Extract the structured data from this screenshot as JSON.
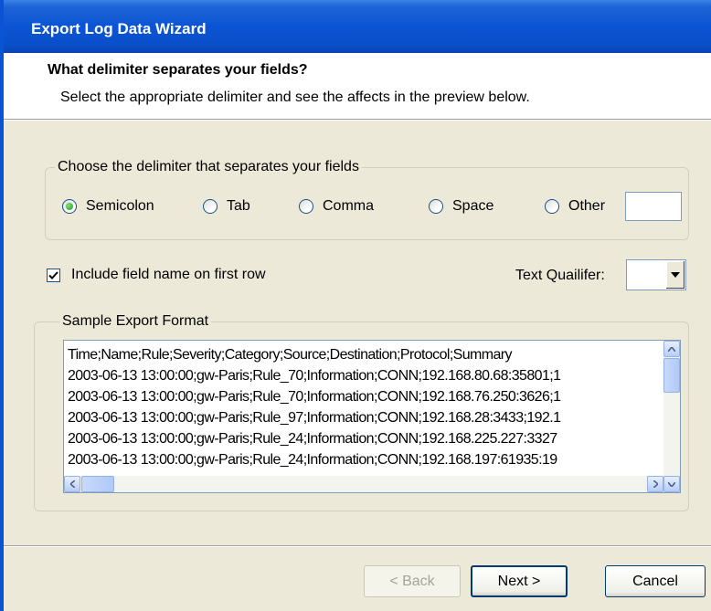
{
  "window": {
    "title": "Export Log Data Wizard"
  },
  "header": {
    "title": "What delimiter separates your fields?",
    "subtitle": "Select the appropriate delimiter and see the affects in the preview below."
  },
  "delimiter_group": {
    "legend": "Choose the delimiter that separates your fields",
    "options": [
      "Semicolon",
      "Tab",
      "Comma",
      "Space",
      "Other"
    ],
    "selected": "Semicolon",
    "other_value": ""
  },
  "include_field_names": {
    "label": "Include field name on first row",
    "checked": true
  },
  "text_qualifier": {
    "label": "Text Quailifer:",
    "value": ""
  },
  "sample_group": {
    "legend": "Sample Export Format",
    "lines": [
      "Time;Name;Rule;Severity;Category;Source;Destination;Protocol;Summary",
      "2003-06-13 13:00:00;gw-Paris;Rule_70;Information;CONN;192.168.80.68:35801;1",
      "2003-06-13 13:00:00;gw-Paris;Rule_70;Information;CONN;192.168.76.250:3626;1",
      "2003-06-13 13:00:00;gw-Paris;Rule_97;Information;CONN;192.168.28:3433;192.1",
      "2003-06-13 13:00:00;gw-Paris;Rule_24;Information;CONN;192.168.225.227:3327",
      "2003-06-13 13:00:00;gw-Paris;Rule_24;Information;CONN;192.168.197:61935:19"
    ]
  },
  "buttons": {
    "back": "< Back",
    "next": "Next >",
    "cancel": "Cancel"
  }
}
